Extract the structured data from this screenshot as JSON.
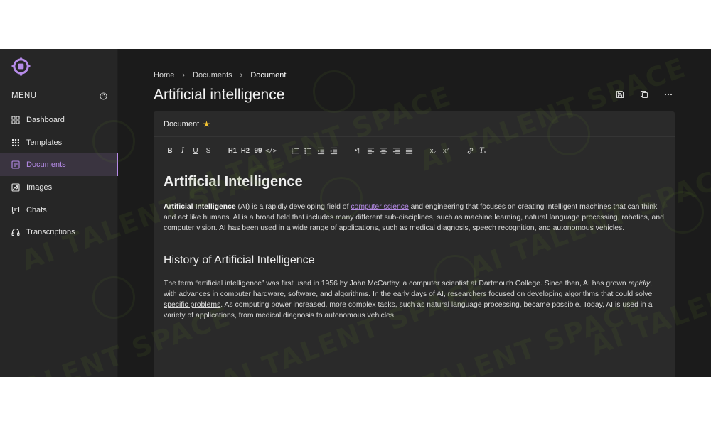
{
  "watermark": "AI TALENT SPACE",
  "colors": {
    "accent": "#b68be8",
    "app_bg": "#1b1b1b",
    "sidebar_bg": "#262626",
    "card_bg": "#2a2a2a",
    "star": "#f1c232"
  },
  "sidebar": {
    "menu_label": "MENU",
    "items": [
      {
        "label": "Dashboard",
        "icon": "grid-icon"
      },
      {
        "label": "Templates",
        "icon": "dots-grid-icon"
      },
      {
        "label": "Documents",
        "icon": "document-icon",
        "active": true
      },
      {
        "label": "Images",
        "icon": "image-icon"
      },
      {
        "label": "Chats",
        "icon": "chat-icon"
      },
      {
        "label": "Transcriptions",
        "icon": "headphones-icon"
      }
    ]
  },
  "breadcrumb": {
    "home": "Home",
    "documents": "Documents",
    "current": "Document"
  },
  "page": {
    "title": "Artificial intelligence"
  },
  "card": {
    "label": "Document"
  },
  "toolbar": {
    "h1": "H1",
    "h2": "H2",
    "quote": "99",
    "code": "</>",
    "subscript": "x₂",
    "superscript": "x²"
  },
  "doc": {
    "heading": "Artificial Intelligence",
    "p1_bold": "Artificial Intelligence",
    "p1_a": " (AI) is a rapidly developing field of ",
    "p1_link": "computer science",
    "p1_b": " and engineering that focuses on creating intelligent machines that can think and act like humans. AI is a broad field that includes many different sub-disciplines, such as machine learning, natural language processing, robotics, and computer vision. AI has been used in a wide range of applications, such as medical diagnosis, speech recognition, and autonomous vehicles.",
    "subheading": "History of Artificial Intelligence",
    "p2_a": "The term “artificial intelligence” was first used in 1956 by John McCarthy, a computer scientist at Dartmouth College. Since then, AI has grown ",
    "p2_italic": "rapidly",
    "p2_b": ", with advances in computer hardware, software, and algorithms. In the early days of AI, researchers focused on developing algorithms that could solve ",
    "p2_underline": "specific problems",
    "p2_c": ". As computing power increased, more complex tasks, such as natural language processing, became possible. Today, AI is used in a variety of applications, from medical diagnosis to autonomous vehicles."
  }
}
